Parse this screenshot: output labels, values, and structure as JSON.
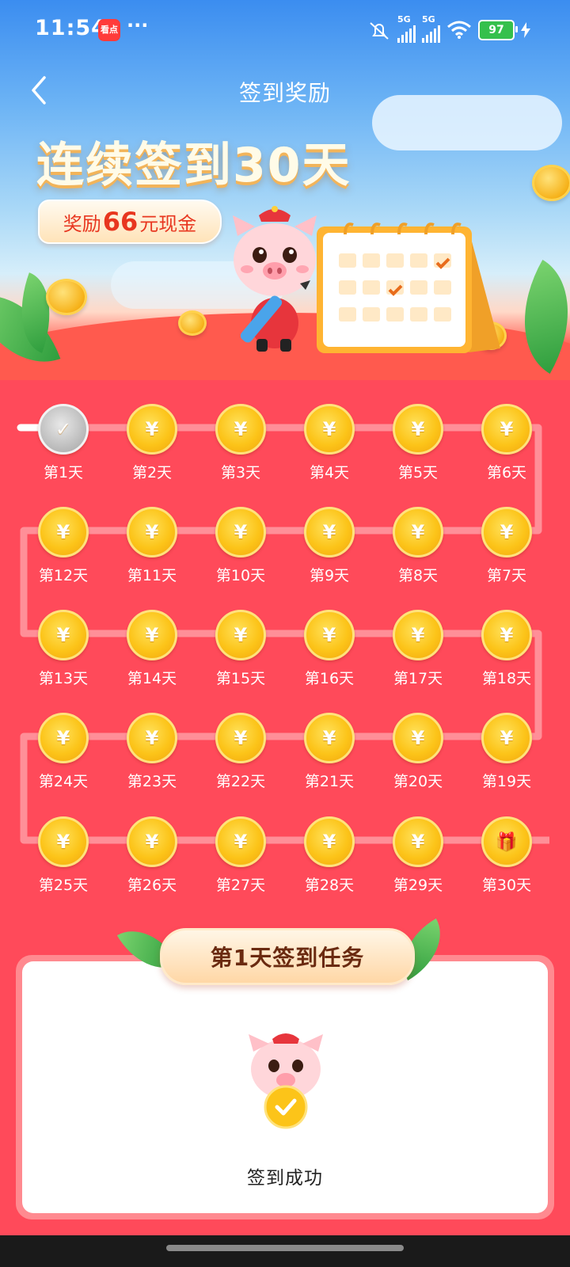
{
  "status_bar": {
    "time": "11:54",
    "app_badge_text": "看点",
    "more": "···",
    "net1": "5G",
    "net2": "5G",
    "battery": "97"
  },
  "nav": {
    "title": "签到奖励"
  },
  "hero": {
    "headline": "连续签到30天",
    "reward_prefix": "奖励",
    "reward_amount": "66",
    "reward_suffix": "元现金"
  },
  "days": [
    {
      "label": "第1天",
      "state": "done"
    },
    {
      "label": "第2天",
      "state": "coin"
    },
    {
      "label": "第3天",
      "state": "coin"
    },
    {
      "label": "第4天",
      "state": "coin"
    },
    {
      "label": "第5天",
      "state": "coin"
    },
    {
      "label": "第6天",
      "state": "coin"
    },
    {
      "label": "第7天",
      "state": "coin"
    },
    {
      "label": "第8天",
      "state": "coin"
    },
    {
      "label": "第9天",
      "state": "coin"
    },
    {
      "label": "第10天",
      "state": "coin"
    },
    {
      "label": "第11天",
      "state": "coin"
    },
    {
      "label": "第12天",
      "state": "coin"
    },
    {
      "label": "第13天",
      "state": "coin"
    },
    {
      "label": "第14天",
      "state": "coin"
    },
    {
      "label": "第15天",
      "state": "coin"
    },
    {
      "label": "第16天",
      "state": "coin"
    },
    {
      "label": "第17天",
      "state": "coin"
    },
    {
      "label": "第18天",
      "state": "coin"
    },
    {
      "label": "第19天",
      "state": "coin"
    },
    {
      "label": "第20天",
      "state": "coin"
    },
    {
      "label": "第21天",
      "state": "coin"
    },
    {
      "label": "第22天",
      "state": "coin"
    },
    {
      "label": "第23天",
      "state": "coin"
    },
    {
      "label": "第24天",
      "state": "coin"
    },
    {
      "label": "第25天",
      "state": "coin"
    },
    {
      "label": "第26天",
      "state": "coin"
    },
    {
      "label": "第27天",
      "state": "coin"
    },
    {
      "label": "第28天",
      "state": "coin"
    },
    {
      "label": "第29天",
      "state": "coin"
    },
    {
      "label": "第30天",
      "state": "gift"
    }
  ],
  "icons": {
    "coin_glyph": "¥",
    "done_glyph": "✓",
    "gift_glyph": "🎁"
  },
  "task_card": {
    "header": "第1天签到任务",
    "status_text": "签到成功"
  },
  "colors": {
    "page_bg": "#ff4a5a",
    "coin": "#fcc419",
    "track": "#ff8f98"
  }
}
